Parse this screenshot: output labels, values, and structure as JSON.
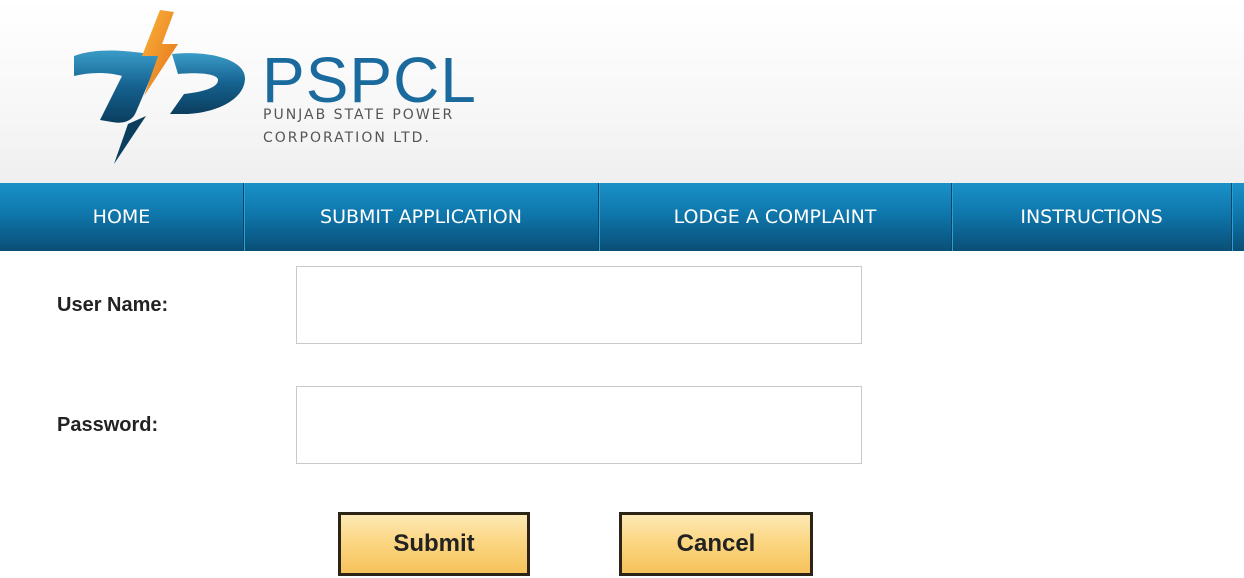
{
  "header": {
    "logo_title": "PSPCL",
    "logo_subtitle_line1": "PUNJAB STATE POWER",
    "logo_subtitle_line2": "CORPORATION LTD.",
    "brand_blue": "#1a6a9e",
    "bolt_orange": "#f39a1e"
  },
  "nav": {
    "items": [
      {
        "label": "HOME"
      },
      {
        "label": "SUBMIT APPLICATION"
      },
      {
        "label": "LODGE A COMPLAINT"
      },
      {
        "label": "INSTRUCTIONS"
      }
    ],
    "bar_color": "#0f77ac"
  },
  "form": {
    "username_label": "User Name:",
    "username_value": "",
    "password_label": "Password:",
    "password_value": "",
    "submit_label": "Submit",
    "cancel_label": "Cancel"
  }
}
